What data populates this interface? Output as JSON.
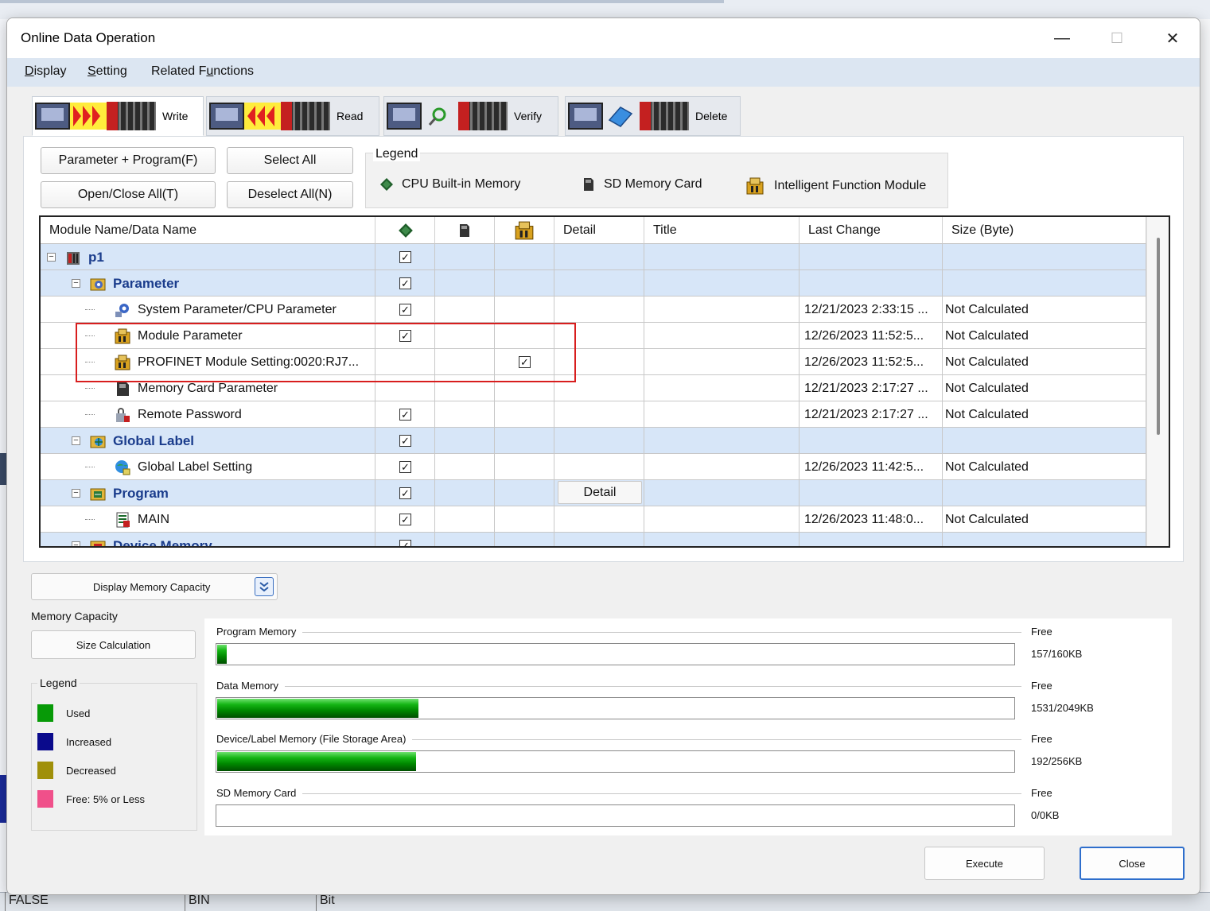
{
  "window": {
    "title": "Online Data Operation",
    "minimize_glyph": "—",
    "maximize_glyph": "☐",
    "close_glyph": "✕"
  },
  "menu": [
    {
      "pre": "",
      "ul": "D",
      "post": "isplay"
    },
    {
      "pre": "",
      "ul": "S",
      "post": "etting"
    },
    {
      "pre": "Related F",
      "ul": "u",
      "post": "nctions"
    }
  ],
  "operations": [
    {
      "label": "Write",
      "icon": "write-arrows-icon",
      "active": true
    },
    {
      "label": "Read",
      "icon": "read-arrows-icon",
      "active": false
    },
    {
      "label": "Verify",
      "icon": "verify-magnifier-icon",
      "active": false
    },
    {
      "label": "Delete",
      "icon": "delete-eraser-icon",
      "active": false
    }
  ],
  "buttons": {
    "param_program": "Parameter + Program(F)",
    "select_all": "Select All",
    "open_close_all": "Open/Close All(T)",
    "deselect_all": "Deselect All(N)"
  },
  "legend": {
    "title": "Legend",
    "items": [
      "CPU Built-in Memory",
      "SD Memory Card",
      "Intelligent Function Module"
    ]
  },
  "table": {
    "columns": [
      "Module Name/Data Name",
      "",
      "",
      "",
      "Detail",
      "Title",
      "Last Change",
      "Size (Byte)"
    ],
    "rows": [
      {
        "level": 0,
        "name": "p1",
        "group": true,
        "icon": "plc-icon",
        "cpu": true,
        "sd": false,
        "ifm": false,
        "detail": "",
        "last_change": "",
        "size": ""
      },
      {
        "level": 1,
        "name": "Parameter",
        "group": true,
        "icon": "parameter-folder-icon",
        "cpu": true,
        "sd": false,
        "ifm": false,
        "detail": "",
        "last_change": "",
        "size": ""
      },
      {
        "level": 2,
        "name": "System Parameter/CPU Parameter",
        "group": false,
        "icon": "system-parameter-icon",
        "cpu": true,
        "sd": false,
        "ifm": false,
        "detail": "",
        "last_change": "12/21/2023 2:33:15 ...",
        "size": "Not Calculated"
      },
      {
        "level": 2,
        "name": "Module Parameter",
        "group": false,
        "icon": "module-parameter-icon",
        "cpu": true,
        "sd": false,
        "ifm": false,
        "detail": "",
        "last_change": "12/26/2023 11:52:5...",
        "size": "Not Calculated"
      },
      {
        "level": 2,
        "name": "PROFINET Module Setting:0020:RJ7...",
        "group": false,
        "icon": "profinet-module-icon",
        "cpu": false,
        "sd": false,
        "ifm": true,
        "detail": "",
        "last_change": "12/26/2023 11:52:5...",
        "size": "Not Calculated"
      },
      {
        "level": 2,
        "name": "Memory Card Parameter",
        "group": false,
        "icon": "memory-card-icon",
        "cpu": false,
        "sd": false,
        "ifm": false,
        "detail": "",
        "last_change": "12/21/2023 2:17:27 ...",
        "size": "Not Calculated"
      },
      {
        "level": 2,
        "name": "Remote Password",
        "group": false,
        "icon": "remote-password-icon",
        "cpu": true,
        "sd": false,
        "ifm": false,
        "detail": "",
        "last_change": "12/21/2023 2:17:27 ...",
        "size": "Not Calculated"
      },
      {
        "level": 1,
        "name": "Global Label",
        "group": true,
        "icon": "global-label-folder-icon",
        "cpu": true,
        "sd": false,
        "ifm": false,
        "detail": "",
        "last_change": "",
        "size": ""
      },
      {
        "level": 2,
        "name": "Global Label Setting",
        "group": false,
        "icon": "global-label-icon",
        "cpu": true,
        "sd": false,
        "ifm": false,
        "detail": "",
        "last_change": "12/26/2023 11:42:5...",
        "size": "Not Calculated"
      },
      {
        "level": 1,
        "name": "Program",
        "group": true,
        "icon": "program-folder-icon",
        "cpu": true,
        "sd": false,
        "ifm": false,
        "detail": "Detail",
        "last_change": "",
        "size": ""
      },
      {
        "level": 2,
        "name": "MAIN",
        "group": false,
        "icon": "program-file-icon",
        "cpu": true,
        "sd": false,
        "ifm": false,
        "detail": "",
        "last_change": "12/26/2023 11:48:0...",
        "size": "Not Calculated"
      },
      {
        "level": 1,
        "name": "Device Memory",
        "group": true,
        "icon": "device-memory-folder-icon",
        "cpu": true,
        "sd": false,
        "ifm": false,
        "detail": "",
        "last_change": "",
        "size": ""
      }
    ]
  },
  "memory": {
    "toggle_label": "Display Memory Capacity",
    "section_label": "Memory Capacity",
    "size_calc_label": "Size Calculation",
    "legend_title": "Legend",
    "legend": [
      {
        "label": "Used",
        "color": "#079a07"
      },
      {
        "label": "Increased",
        "color": "#0a0a8c"
      },
      {
        "label": "Decreased",
        "color": "#a0900a"
      },
      {
        "label": "Free: 5% or Less",
        "color": "#f0508a"
      }
    ],
    "free_label": "Free",
    "bars": [
      {
        "name": "Program Memory",
        "free": "157/160KB",
        "used_fraction": 0.012
      },
      {
        "name": "Data Memory",
        "free": "1531/2049KB",
        "used_fraction": 0.253
      },
      {
        "name": "Device/Label Memory (File Storage Area)",
        "free": "192/256KB",
        "used_fraction": 0.25
      },
      {
        "name": "SD Memory Card",
        "free": "0/0KB",
        "used_fraction": 0
      }
    ]
  },
  "footer": {
    "execute": "Execute",
    "close": "Close"
  },
  "background_app": {
    "cells": [
      "FALSE",
      "BIN",
      "Bit"
    ]
  }
}
